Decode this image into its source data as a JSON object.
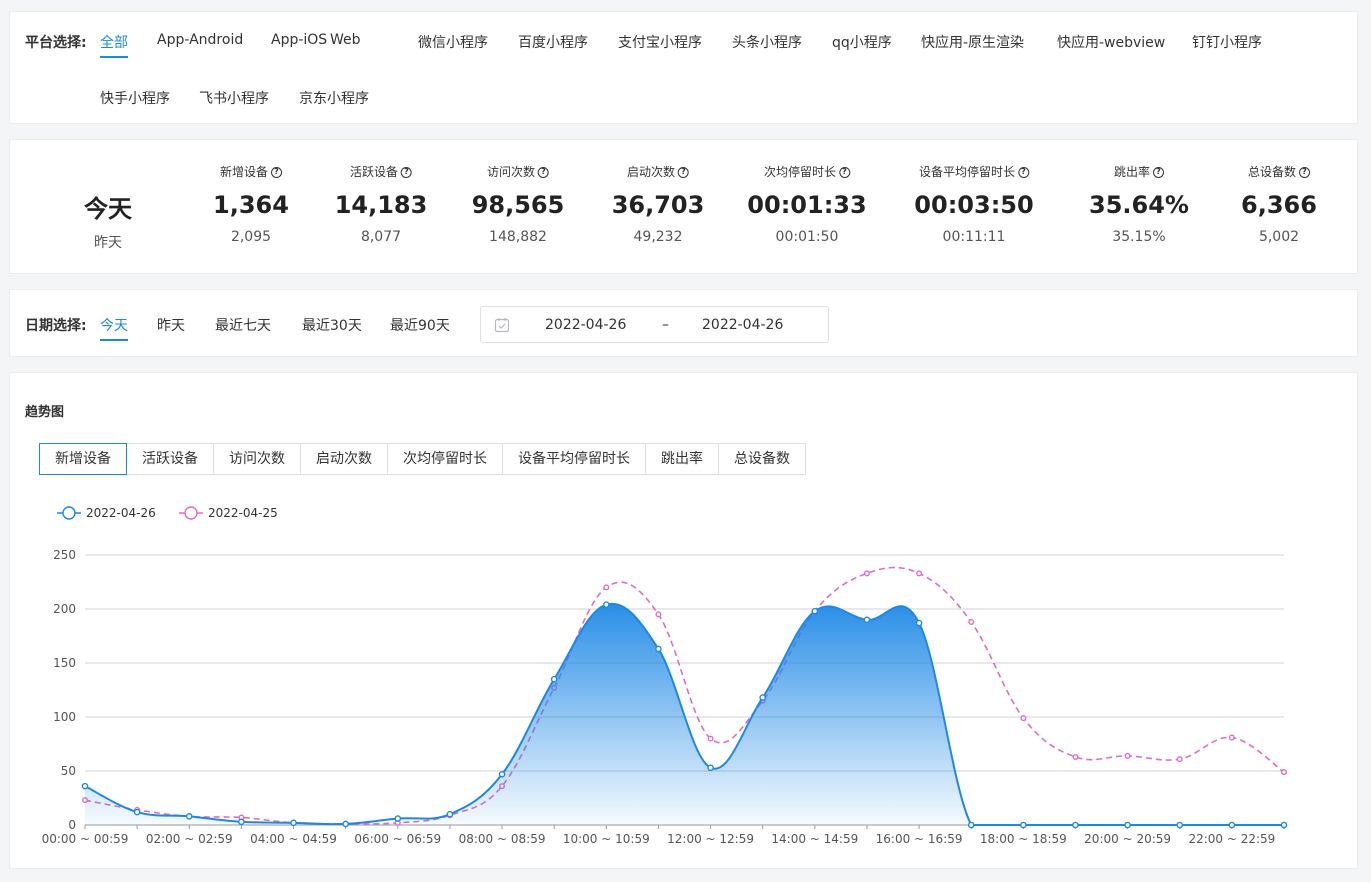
{
  "platform": {
    "label": "平台选择:",
    "items": [
      "全部",
      "App-Android",
      "App-iOS",
      "Web",
      "微信小程序",
      "百度小程序",
      "支付宝小程序",
      "头条小程序",
      "qq小程序",
      "快应用-原生渲染",
      "快应用-webview",
      "钉钉小程序",
      "快手小程序",
      "飞书小程序",
      "京东小程序"
    ],
    "active": "全部"
  },
  "stats": {
    "today_label": "今天",
    "yesterday_label": "昨天",
    "items": [
      {
        "label": "新增设备",
        "today": "1,364",
        "yesterday": "2,095"
      },
      {
        "label": "活跃设备",
        "today": "14,183",
        "yesterday": "8,077"
      },
      {
        "label": "访问次数",
        "today": "98,565",
        "yesterday": "148,882"
      },
      {
        "label": "启动次数",
        "today": "36,703",
        "yesterday": "49,232"
      },
      {
        "label": "次均停留时长",
        "today": "00:01:33",
        "yesterday": "00:01:50"
      },
      {
        "label": "设备平均停留时长",
        "today": "00:03:50",
        "yesterday": "00:11:11"
      },
      {
        "label": "跳出率",
        "today": "35.64%",
        "yesterday": "35.15%"
      },
      {
        "label": "总设备数",
        "today": "6,366",
        "yesterday": "5,002"
      }
    ]
  },
  "date_filter": {
    "label": "日期选择:",
    "options": [
      "今天",
      "昨天",
      "最近七天",
      "最近30天",
      "最近90天"
    ],
    "active": "今天",
    "start": "2022-04-26",
    "separator": "–",
    "end": "2022-04-26"
  },
  "trend": {
    "title": "趋势图",
    "tabs": [
      "新增设备",
      "活跃设备",
      "访问次数",
      "启动次数",
      "次均停留时长",
      "设备平均停留时长",
      "跳出率",
      "总设备数"
    ],
    "active_tab": "新增设备"
  },
  "chart_data": {
    "type": "line",
    "title": "",
    "xlabel": "",
    "ylabel": "",
    "ylim": [
      0,
      250
    ],
    "yticks": [
      0,
      50,
      100,
      150,
      200,
      250
    ],
    "grid": true,
    "legend_position": "top-left",
    "categories": [
      "00:00 ~ 00:59",
      "01:00 ~ 01:59",
      "02:00 ~ 02:59",
      "03:00 ~ 03:59",
      "04:00 ~ 04:59",
      "05:00 ~ 05:59",
      "06:00 ~ 06:59",
      "07:00 ~ 07:59",
      "08:00 ~ 08:59",
      "09:00 ~ 09:59",
      "10:00 ~ 10:59",
      "11:00 ~ 11:59",
      "12:00 ~ 12:59",
      "13:00 ~ 13:59",
      "14:00 ~ 14:59",
      "15:00 ~ 15:59",
      "16:00 ~ 16:59",
      "17:00 ~ 17:59",
      "18:00 ~ 18:59",
      "19:00 ~ 19:59",
      "20:00 ~ 20:59",
      "21:00 ~ 21:59",
      "22:00 ~ 22:59",
      "23:00 ~ 23:59"
    ],
    "shown_tick_labels": [
      "00:00 ~ 00:59",
      "02:00 ~ 02:59",
      "04:00 ~ 04:59",
      "06:00 ~ 06:59",
      "08:00 ~ 08:59",
      "10:00 ~ 10:59",
      "12:00 ~ 12:59",
      "14:00 ~ 14:59",
      "16:00 ~ 16:59",
      "18:00 ~ 18:59",
      "20:00 ~ 20:59",
      "22:00 ~ 22:59"
    ],
    "series": [
      {
        "name": "2022-04-26",
        "color": "#1e88e5",
        "style": "solid-area",
        "values": [
          36,
          12,
          8,
          3,
          2,
          1,
          6,
          10,
          47,
          135,
          204,
          163,
          53,
          118,
          198,
          190,
          187,
          0,
          0,
          0,
          0,
          0,
          0,
          0
        ]
      },
      {
        "name": "2022-04-25",
        "color": "#e06cc6",
        "style": "dashed",
        "values": [
          23,
          14,
          8,
          7,
          2,
          1,
          2,
          9,
          36,
          127,
          220,
          195,
          80,
          115,
          198,
          233,
          233,
          188,
          99,
          63,
          64,
          61,
          81,
          49
        ]
      }
    ]
  }
}
